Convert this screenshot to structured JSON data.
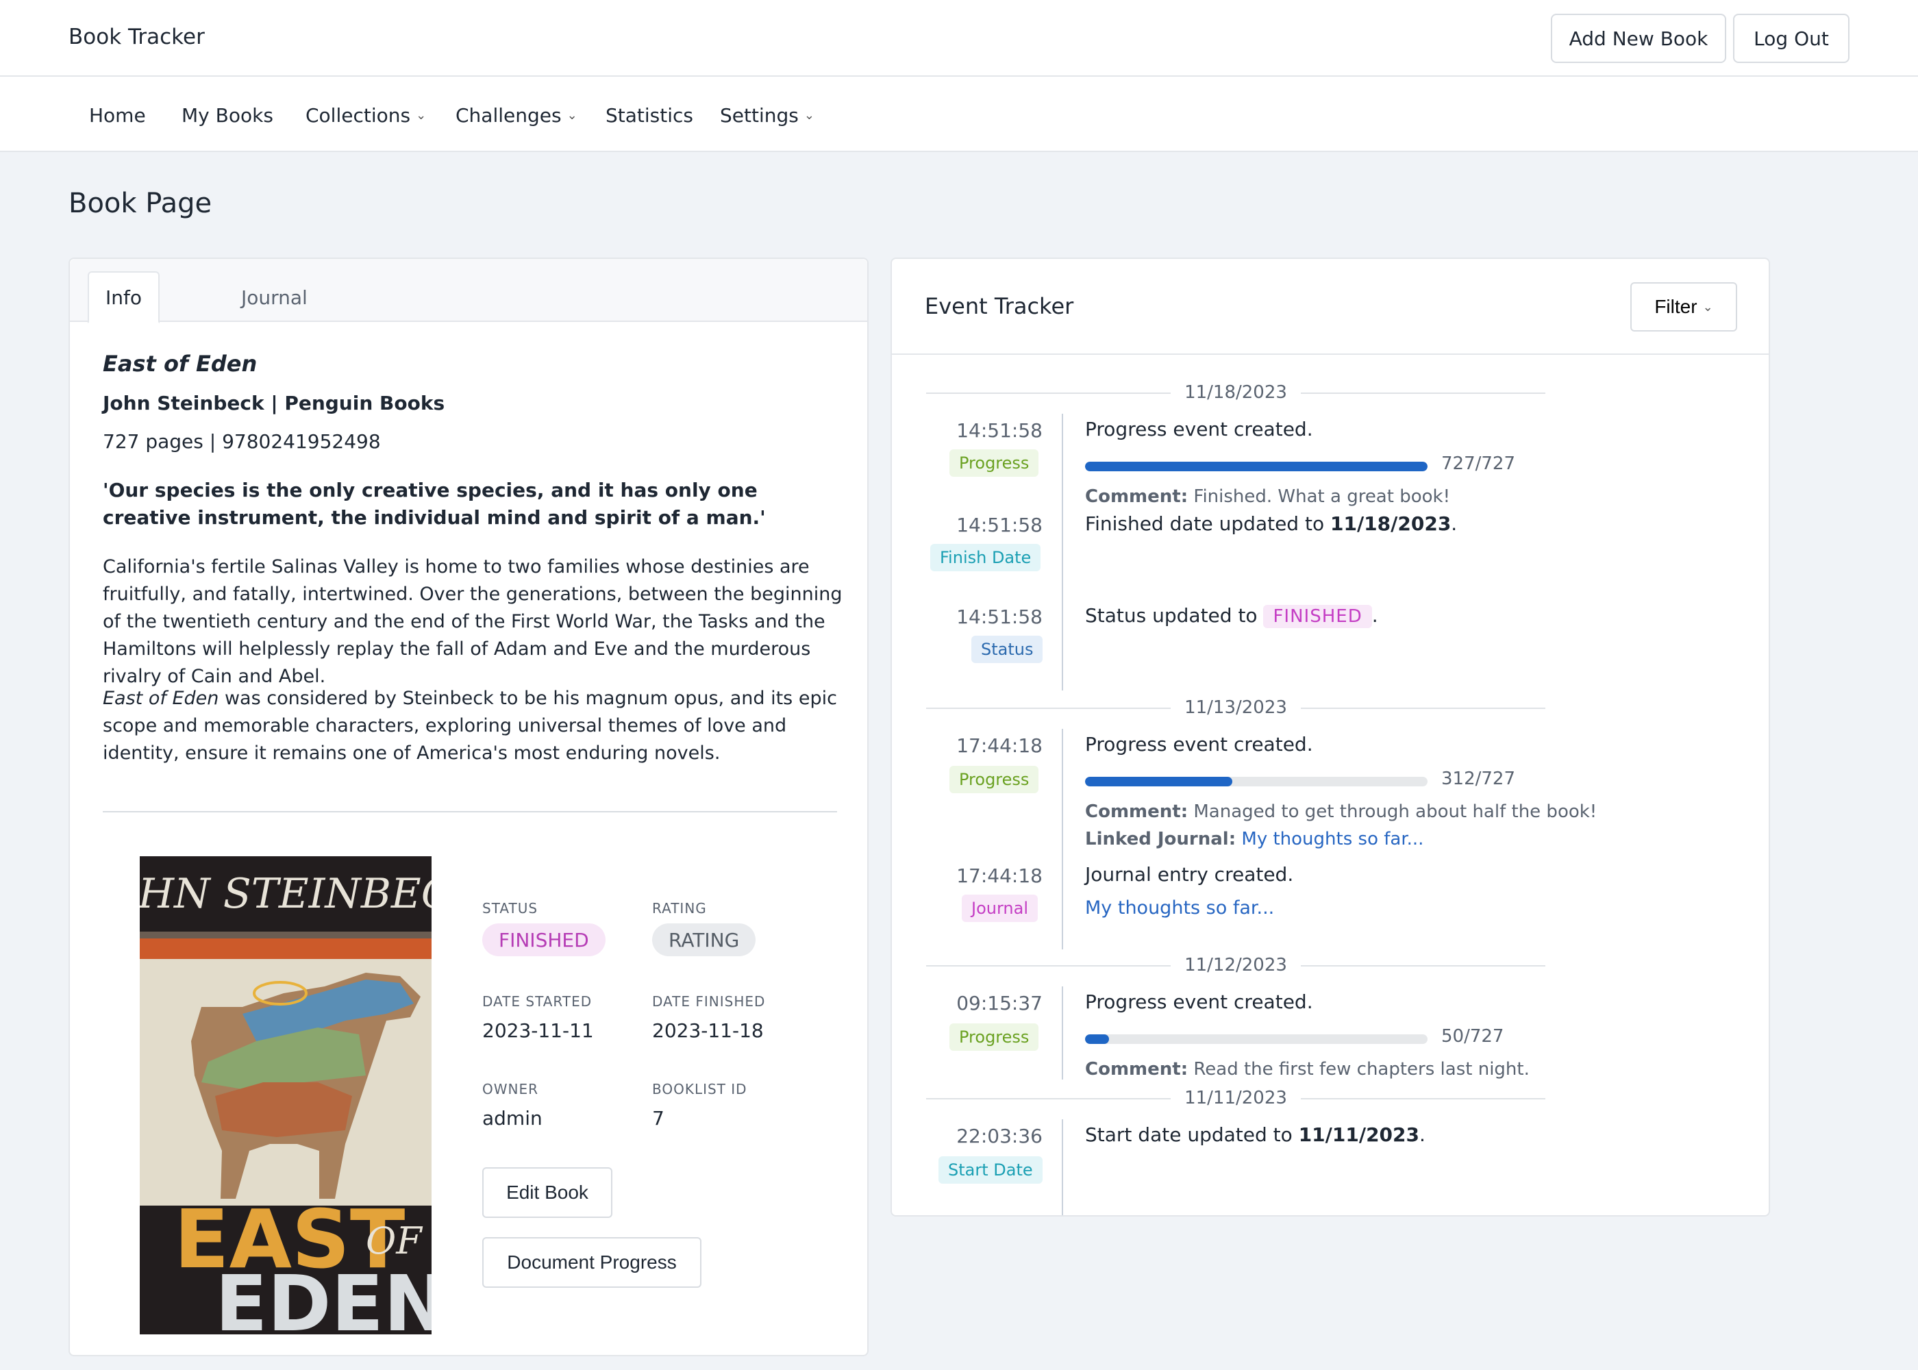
{
  "header": {
    "brand": "Book Tracker",
    "add_book_label": "Add New Book",
    "logout_label": "Log Out"
  },
  "nav": {
    "items": [
      {
        "label": "Home"
      },
      {
        "label": "My Books"
      },
      {
        "label": "Collections"
      },
      {
        "label": "Challenges"
      },
      {
        "label": "Statistics"
      },
      {
        "label": "Settings"
      }
    ]
  },
  "page": {
    "title": "Book Page"
  },
  "tabs": [
    {
      "label": "Info"
    },
    {
      "label": "Journal"
    }
  ],
  "book": {
    "title": "East of Eden",
    "author_line": "John Steinbeck | Penguin Books",
    "meta_line": "727 pages | 9780241952498",
    "quote": "'Our species is the only creative species, and it has only one creative instrument, the individual mind and spirit of a man.'",
    "description": "California's fertile Salinas Valley is home to two families whose destinies are fruitfully, and fatally, intertwined. Over the generations, between the beginning of the twentieth century and the end of the First World War, the Tasks and the Hamiltons will helplessly replay the fall of Adam and Eve and the murderous rivalry of Cain and Abel.",
    "description2_italic": "East of Eden",
    "description2_rest": " was considered by Steinbeck to be his magnum opus, and its epic scope and memorable characters, exploring universal themes of love and identity, ensure it remains one of America's most enduring novels.",
    "cover": {
      "author_text": "JOHN STEINBECK",
      "title_word1": "EAST",
      "title_word2": "OF",
      "title_word3": "EDEN"
    }
  },
  "details": {
    "status_label": "STATUS",
    "status_value": "FINISHED",
    "rating_label": "RATING",
    "rating_value": "RATING",
    "date_started_label": "DATE STARTED",
    "date_started_value": "2023-11-11",
    "date_finished_label": "DATE FINISHED",
    "date_finished_value": "2023-11-18",
    "owner_label": "OWNER",
    "owner_value": "admin",
    "booklist_label": "BOOKLIST ID",
    "booklist_value": "7",
    "edit_label": "Edit Book",
    "document_label": "Document Progress"
  },
  "events": {
    "title": "Event Tracker",
    "filter_label": "Filter",
    "dates": [
      "11/18/2023",
      "11/13/2023",
      "11/12/2023",
      "11/11/2023"
    ],
    "e1": {
      "time": "14:51:58",
      "badge": "Progress",
      "text": "Progress event created.",
      "progress": 1.0,
      "count": "727/727",
      "comment_label": "Comment:",
      "comment": "Finished. What a great book!"
    },
    "e2": {
      "time": "14:51:58",
      "badge": "Finish Date",
      "text_pre": "Finished date updated to ",
      "text_bold": "11/18/2023",
      "text_post": "."
    },
    "e3": {
      "time": "14:51:58",
      "badge": "Status",
      "text_pre": "Status updated to ",
      "status": "FINISHED",
      "text_post": "."
    },
    "e4": {
      "time": "17:44:18",
      "badge": "Progress",
      "text": "Progress event created.",
      "progress": 0.429,
      "count": "312/727",
      "comment_label": "Comment:",
      "comment": "Managed to get through about half the book!",
      "journal_label": "Linked Journal:",
      "journal_link": "My thoughts so far..."
    },
    "e5": {
      "time": "17:44:18",
      "badge": "Journal",
      "text": "Journal entry created.",
      "link": "My thoughts so far..."
    },
    "e6": {
      "time": "09:15:37",
      "badge": "Progress",
      "text": "Progress event created.",
      "progress": 0.069,
      "count": "50/727",
      "comment_label": "Comment:",
      "comment": "Read the first few chapters last night."
    },
    "e7": {
      "time": "22:03:36",
      "badge": "Start Date",
      "text_pre": "Start date updated to ",
      "text_bold": "11/11/2023",
      "text_post": "."
    }
  }
}
